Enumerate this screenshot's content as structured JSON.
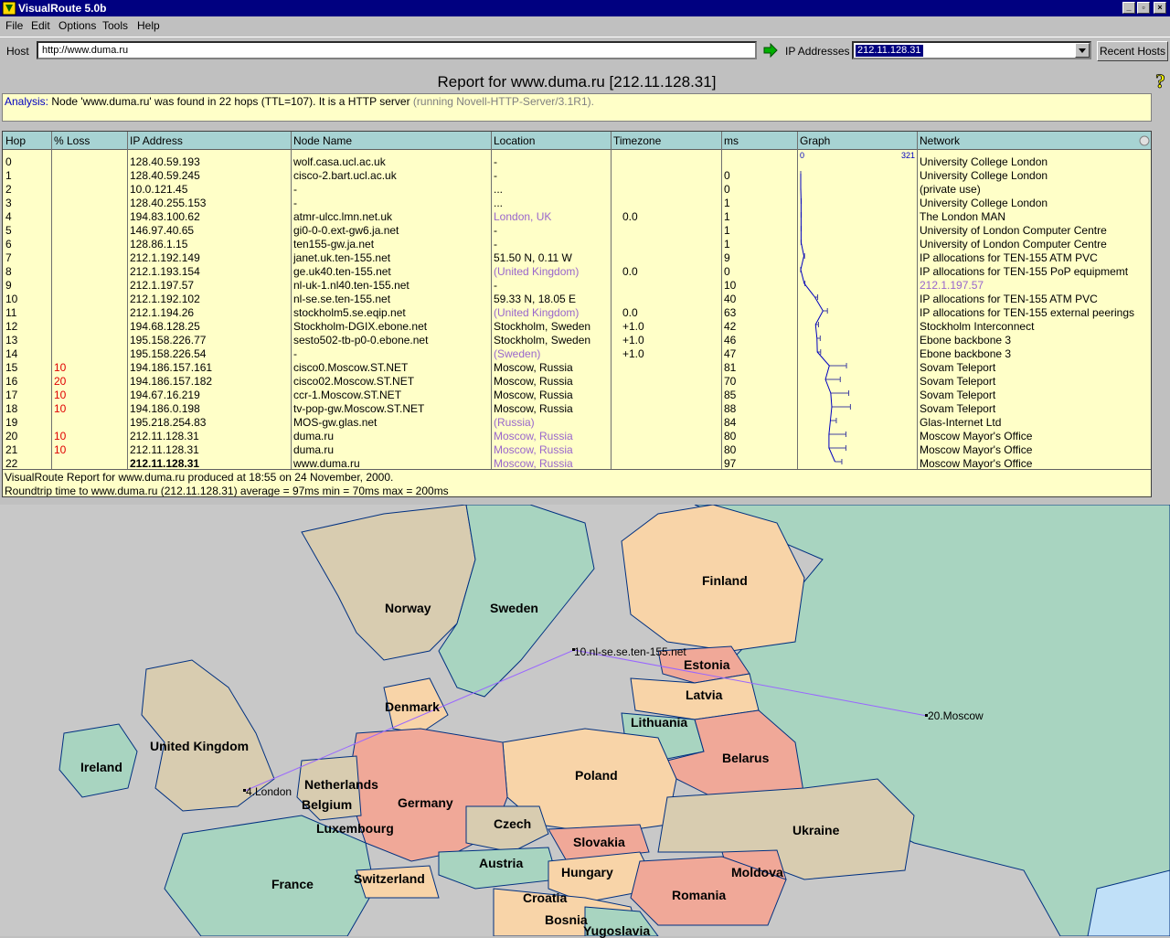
{
  "window": {
    "title": "VisualRoute 5.0b"
  },
  "menu": [
    "File",
    "Edit",
    "Options",
    "Tools",
    "Help"
  ],
  "toolbar": {
    "host_label": "Host",
    "host_value": "http://www.duma.ru",
    "ip_label": "IP Addresses",
    "ip_value": "212.11.128.31",
    "recent_hosts": "Recent Hosts"
  },
  "report": {
    "title": "Report for www.duma.ru [212.11.128.31]",
    "analysis_label": "Analysis:",
    "analysis_text": " Node 'www.duma.ru' was found in 22 hops (TTL=107). It is a HTTP server ",
    "analysis_server": "(running Novell-HTTP-Server/3.1R1)."
  },
  "table": {
    "headers": [
      "Hop",
      "% Loss",
      "IP Address",
      "Node Name",
      "Location",
      "Timezone",
      "ms",
      "Graph",
      "Network"
    ],
    "graph_scale_min": "0",
    "graph_scale_max": "321",
    "rows": [
      {
        "hop": "0",
        "loss": "",
        "ip": "128.40.59.193",
        "node": "wolf.casa.ucl.ac.uk",
        "loc": "-",
        "tz": "",
        "ms": "",
        "net": "University College London"
      },
      {
        "hop": "1",
        "loss": "",
        "ip": "128.40.59.245",
        "node": "cisco-2.bart.ucl.ac.uk",
        "loc": "-",
        "tz": "",
        "ms": "0",
        "net": "University College London"
      },
      {
        "hop": "2",
        "loss": "",
        "ip": "10.0.121.45",
        "node": "-",
        "loc": "...",
        "tz": "",
        "ms": "0",
        "net": "(private use)"
      },
      {
        "hop": "3",
        "loss": "",
        "ip": "128.40.255.153",
        "node": "-",
        "loc": "...",
        "tz": "",
        "ms": "1",
        "net": "University College London"
      },
      {
        "hop": "4",
        "loss": "",
        "ip": "194.83.100.62",
        "node": "atmr-ulcc.lmn.net.uk",
        "loc": "London, UK",
        "tz": "0.0",
        "ms": "1",
        "net": "The London MAN"
      },
      {
        "hop": "5",
        "loss": "",
        "ip": "146.97.40.65",
        "node": "gi0-0-0.ext-gw6.ja.net",
        "loc": "-",
        "tz": "",
        "ms": "1",
        "net": "University of London Computer Centre"
      },
      {
        "hop": "6",
        "loss": "",
        "ip": "128.86.1.15",
        "node": "ten155-gw.ja.net",
        "loc": "-",
        "tz": "",
        "ms": "1",
        "net": "University of London Computer Centre"
      },
      {
        "hop": "7",
        "loss": "",
        "ip": "212.1.192.149",
        "node": "janet.uk.ten-155.net",
        "loc": "51.50 N, 0.11 W",
        "tz": "",
        "ms": "9",
        "net": "IP allocations for TEN-155 ATM PVC"
      },
      {
        "hop": "8",
        "loss": "",
        "ip": "212.1.193.154",
        "node": "ge.uk40.ten-155.net",
        "loc": "(United Kingdom)",
        "tz": "0.0",
        "ms": "0",
        "net": "IP allocations for TEN-155 PoP equipmemt"
      },
      {
        "hop": "9",
        "loss": "",
        "ip": "212.1.197.57",
        "node": "nl-uk-1.nl40.ten-155.net",
        "loc": "-",
        "tz": "",
        "ms": "10",
        "net": "212.1.197.57"
      },
      {
        "hop": "10",
        "loss": "",
        "ip": "212.1.192.102",
        "node": "nl-se.se.ten-155.net",
        "loc": "59.33 N, 18.05 E",
        "tz": "",
        "ms": "40",
        "net": "IP allocations for TEN-155 ATM PVC"
      },
      {
        "hop": "11",
        "loss": "",
        "ip": "212.1.194.26",
        "node": "stockholm5.se.eqip.net",
        "loc": "(United Kingdom)",
        "tz": "0.0",
        "ms": "63",
        "net": "IP allocations for TEN-155 external peerings"
      },
      {
        "hop": "12",
        "loss": "",
        "ip": "194.68.128.25",
        "node": "Stockholm-DGIX.ebone.net",
        "loc": "Stockholm, Sweden",
        "tz": "+1.0",
        "ms": "42",
        "net": "Stockholm Interconnect"
      },
      {
        "hop": "13",
        "loss": "",
        "ip": "195.158.226.77",
        "node": "sesto502-tb-p0-0.ebone.net",
        "loc": "Stockholm, Sweden",
        "tz": "+1.0",
        "ms": "46",
        "net": "Ebone backbone 3"
      },
      {
        "hop": "14",
        "loss": "",
        "ip": "195.158.226.54",
        "node": "-",
        "loc": "(Sweden)",
        "tz": "+1.0",
        "ms": "47",
        "net": "Ebone backbone 3"
      },
      {
        "hop": "15",
        "loss": "10",
        "ip": "194.186.157.161",
        "node": "cisco0.Moscow.ST.NET",
        "loc": "Moscow, Russia",
        "tz": "",
        "ms": "81",
        "net": "Sovam Teleport"
      },
      {
        "hop": "16",
        "loss": "20",
        "ip": "194.186.157.182",
        "node": "cisco02.Moscow.ST.NET",
        "loc": "Moscow, Russia",
        "tz": "",
        "ms": "70",
        "net": "Sovam Teleport"
      },
      {
        "hop": "17",
        "loss": "10",
        "ip": "194.67.16.219",
        "node": "ccr-1.Moscow.ST.NET",
        "loc": "Moscow, Russia",
        "tz": "",
        "ms": "85",
        "net": "Sovam Teleport"
      },
      {
        "hop": "18",
        "loss": "10",
        "ip": "194.186.0.198",
        "node": "tv-pop-gw.Moscow.ST.NET",
        "loc": "Moscow, Russia",
        "tz": "",
        "ms": "88",
        "net": "Sovam Teleport"
      },
      {
        "hop": "19",
        "loss": "",
        "ip": "195.218.254.83",
        "node": "MOS-gw.glas.net",
        "loc": "(Russia)",
        "tz": "",
        "ms": "84",
        "net": "Glas-Internet Ltd"
      },
      {
        "hop": "20",
        "loss": "10",
        "ip": "212.11.128.31",
        "node": "duma.ru",
        "loc": "Moscow, Russia",
        "tz": "",
        "ms": "80",
        "net": "Moscow Mayor's Office"
      },
      {
        "hop": "21",
        "loss": "10",
        "ip": "212.11.128.31",
        "node": "duma.ru",
        "loc": "Moscow, Russia",
        "tz": "",
        "ms": "80",
        "net": "Moscow Mayor's Office"
      },
      {
        "hop": "22",
        "loss": "",
        "ip": "212.11.128.31",
        "node": "www.duma.ru",
        "loc": "Moscow, Russia",
        "tz": "",
        "ms": "97",
        "net": "Moscow Mayor's Office"
      }
    ],
    "footer_line1": "VisualRoute Report for www.duma.ru produced at 18:55 on 24 November, 2000.",
    "footer_line2": "Roundtrip time to www.duma.ru (212.11.128.31) average = 97ms min = 70ms max = 200ms"
  },
  "map": {
    "countries": [
      "Finland",
      "Norway",
      "Sweden",
      "Estonia",
      "Latvia",
      "Denmark",
      "Lithuania",
      "United Kingdom",
      "Belarus",
      "Ireland",
      "Netherlands",
      "Poland",
      "Belgium",
      "Germany",
      "Luxembourg",
      "Czech",
      "Ukraine",
      "Slovakia",
      "Austria",
      "Hungary",
      "France",
      "Switzerland",
      "Moldova",
      "Romania",
      "Croatia",
      "Bosnia",
      "Yugoslavia"
    ],
    "hops": [
      "10.nl-se.se.ten-155.net",
      "20.Moscow",
      "4.London"
    ],
    "colors": {
      "sea": "#c8c8c8",
      "green": "#a8d4c0",
      "peach": "#f8d4a8",
      "pink": "#f0a898",
      "tan": "#d8ccb0",
      "route": "#9966ff"
    }
  }
}
